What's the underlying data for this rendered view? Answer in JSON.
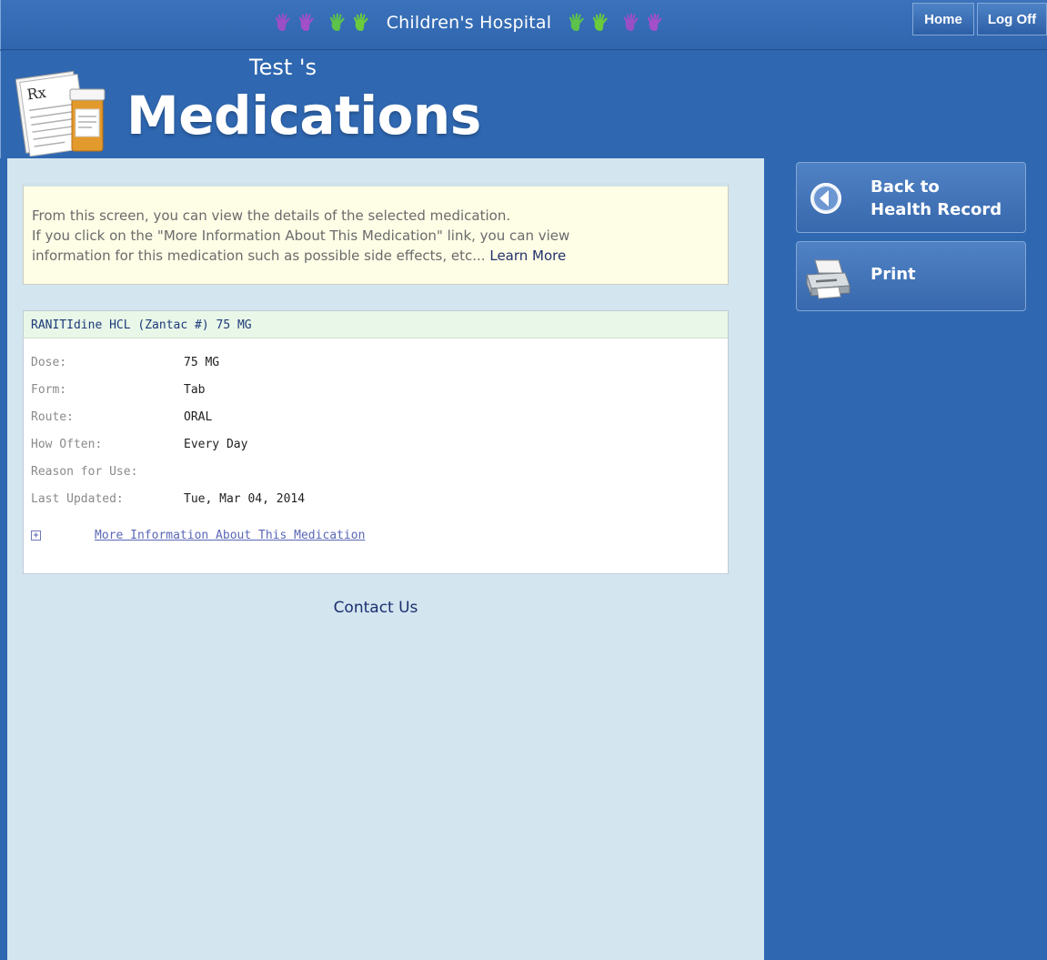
{
  "banner": {
    "hospital_name": "Children's Hospital"
  },
  "nav": {
    "home_label": "Home",
    "logoff_label": "Log Off"
  },
  "header": {
    "owner_name": "Test",
    "owner_suffix": "'s",
    "title": "Medications"
  },
  "info": {
    "line1": "From this screen, you can view the details of the selected medication.",
    "line2": "If you click on the \"More Information About This Medication\" link, you can view",
    "line3": "information for this medication such as possible side effects, etc...",
    "learn_more": "Learn More"
  },
  "medication": {
    "title": "RANITIdine HCL (Zantac #) 75 MG",
    "details": [
      {
        "label": "Dose:",
        "value": "75 MG"
      },
      {
        "label": "Form:",
        "value": "Tab"
      },
      {
        "label": "Route:",
        "value": "ORAL"
      },
      {
        "label": "How Often:",
        "value": "Every Day"
      },
      {
        "label": "Reason for Use:",
        "value": ""
      },
      {
        "label": "Last Updated:",
        "value": "Tue, Mar 04, 2014"
      }
    ],
    "more_info_label": "More Information About This Medication",
    "expand_glyph": "+"
  },
  "footer": {
    "contact_label": "Contact Us"
  },
  "sidebar": {
    "back_line1": "Back to",
    "back_line2": "Health Record",
    "print_label": "Print"
  },
  "colors": {
    "page_blue": "#2f67b0",
    "content_bg": "#d3e5ef",
    "info_bg": "#fefde6",
    "med_title_bg": "#e8f7e8",
    "link_color": "#5a67b5"
  },
  "icons": {
    "hands": "hand-print-icon",
    "rx_logo": "rx-prescription-icon",
    "back": "back-arrow-icon",
    "print": "printer-icon",
    "expand": "plus-expand-icon"
  }
}
